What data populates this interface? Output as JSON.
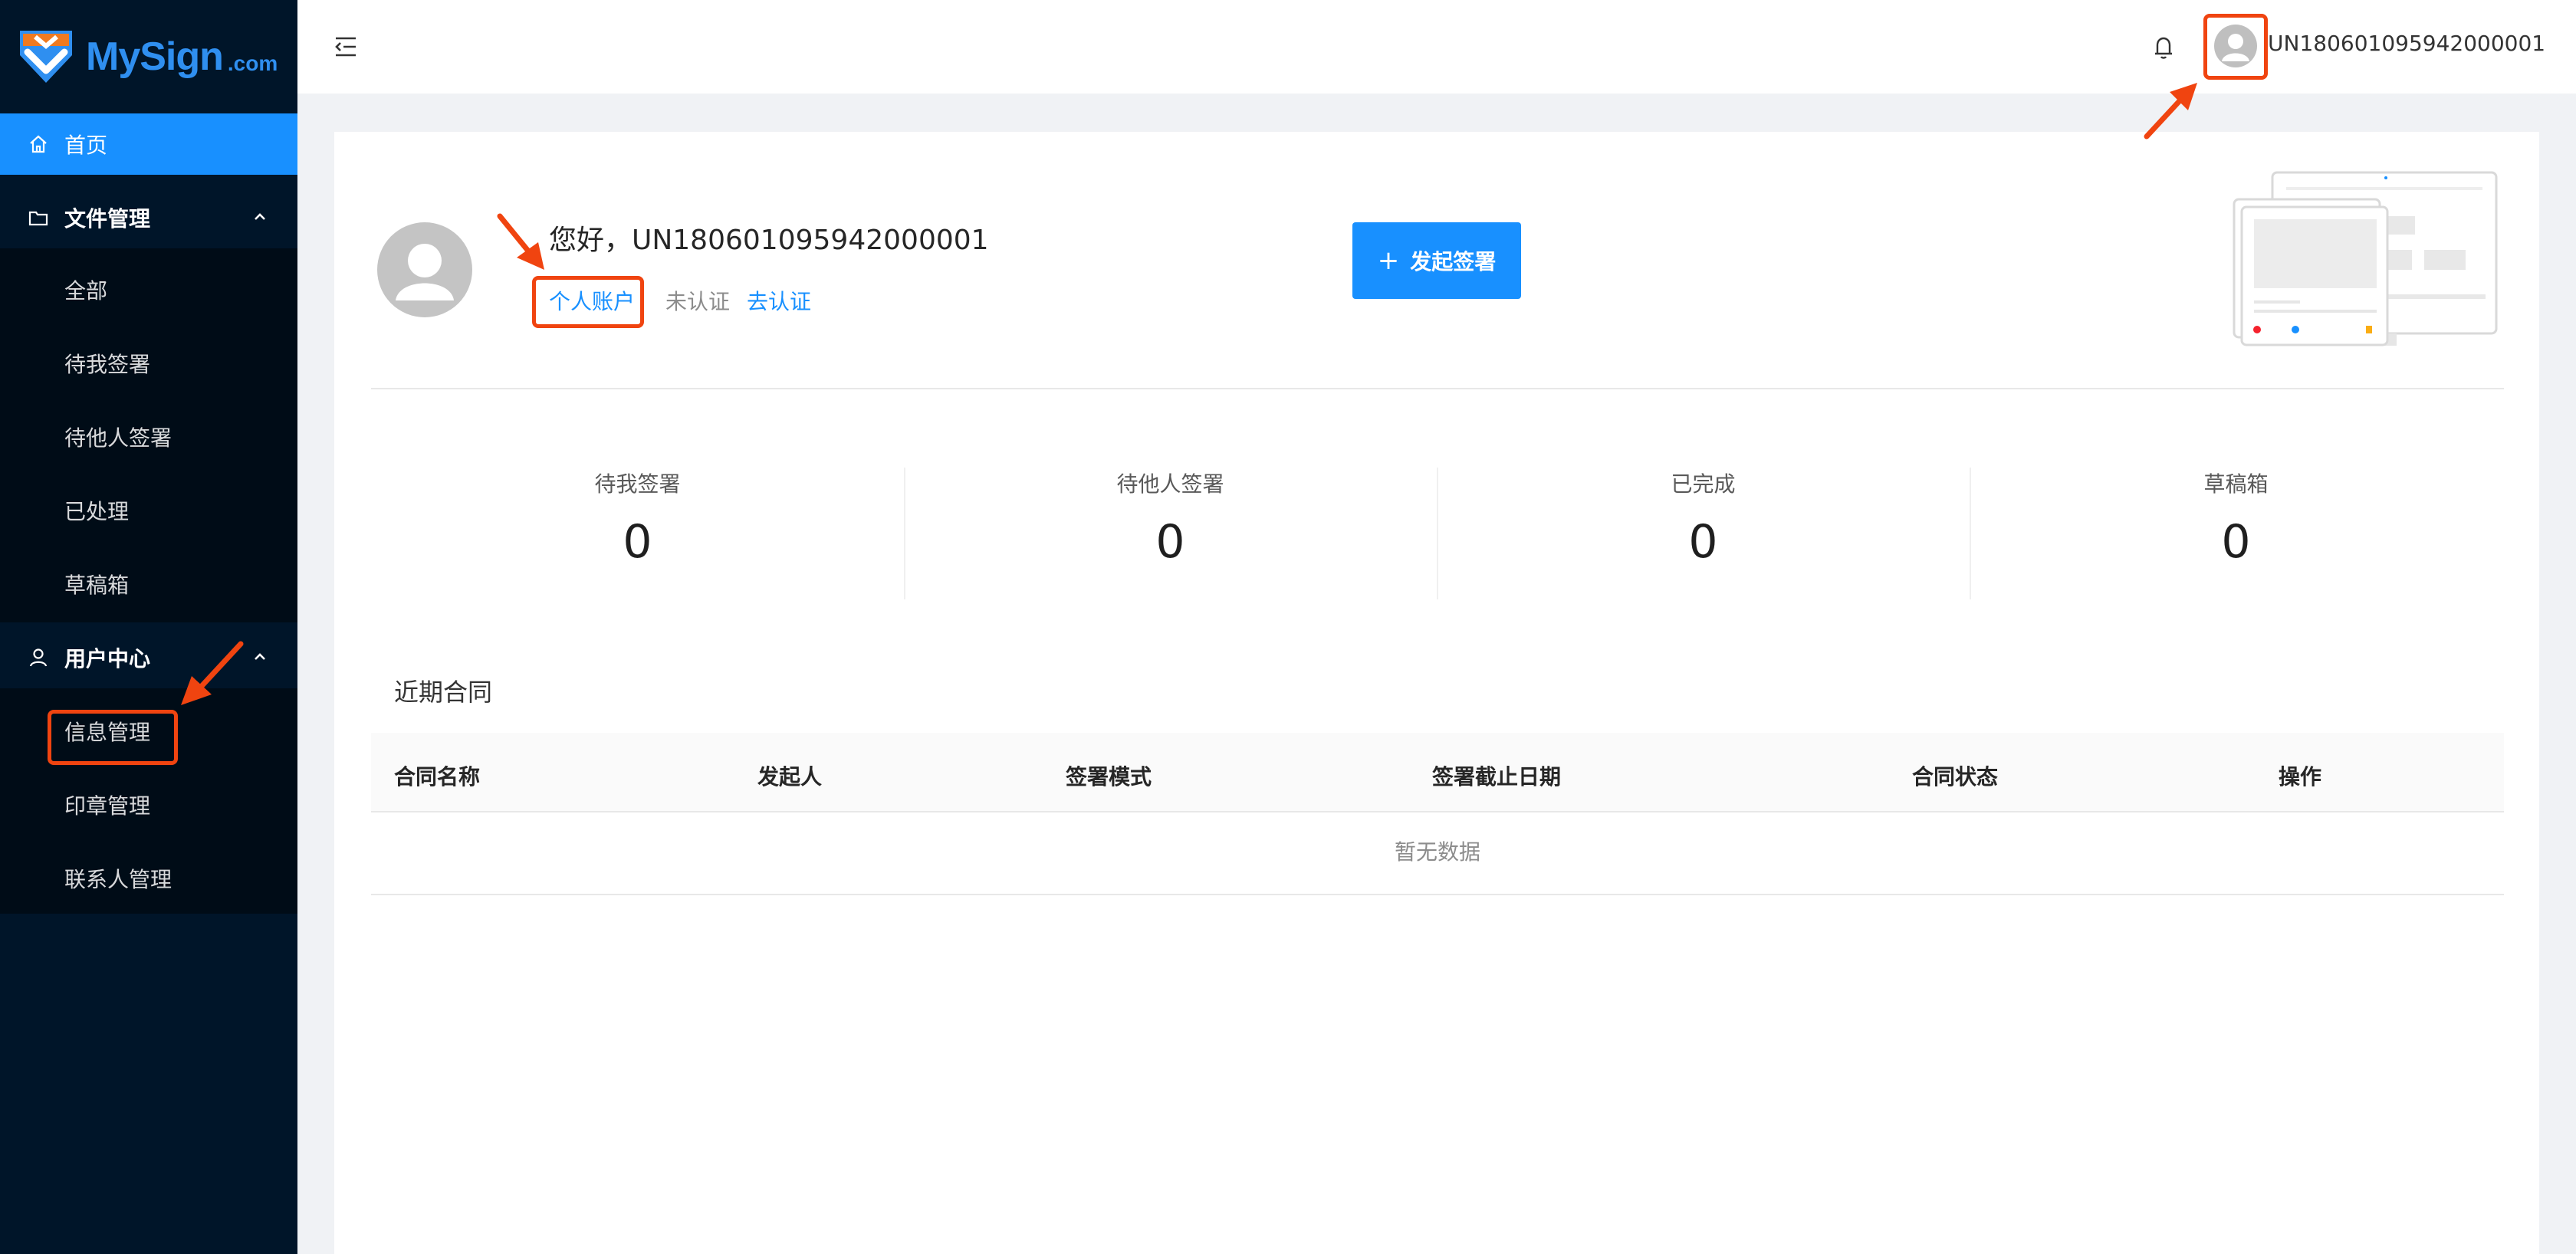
{
  "brand": {
    "name": "MySign",
    "suffix": ".com"
  },
  "sidebar": {
    "home": "首页",
    "file_mgmt": {
      "label": "文件管理",
      "items": [
        "全部",
        "待我签署",
        "待他人签署",
        "已处理",
        "草稿箱"
      ]
    },
    "user_center": {
      "label": "用户中心",
      "items": [
        "信息管理",
        "印章管理",
        "联系人管理"
      ]
    }
  },
  "header": {
    "username": "UN180601095942000001"
  },
  "profile": {
    "greeting": "您好，UN180601095942000001",
    "account_type": "个人账户",
    "verify_status": "未认证",
    "verify_link": "去认证",
    "initiate_button": "发起签署"
  },
  "stats": [
    {
      "label": "待我签署",
      "value": "0"
    },
    {
      "label": "待他人签署",
      "value": "0"
    },
    {
      "label": "已完成",
      "value": "0"
    },
    {
      "label": "草稿箱",
      "value": "0"
    }
  ],
  "recent": {
    "title": "近期合同",
    "columns": [
      "合同名称",
      "发起人",
      "签署模式",
      "签署截止日期",
      "合同状态",
      "操作"
    ],
    "empty_text": "暂无数据"
  },
  "colors": {
    "sidebar_bg": "#001529",
    "accent": "#1890ff",
    "annotation": "#f04410"
  }
}
